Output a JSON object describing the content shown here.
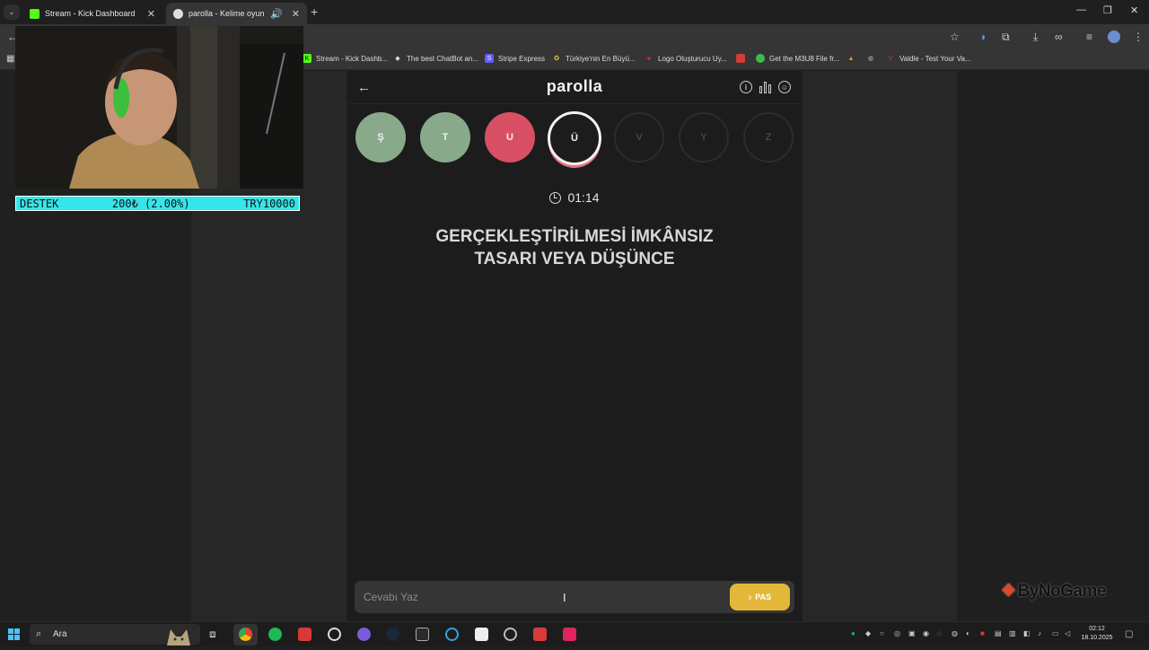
{
  "browser": {
    "tabs": [
      {
        "title": "Stream - Kick Dashboard",
        "favicon_color": "#53fc18"
      },
      {
        "title": "parolla - Kelime oyunu. Gün",
        "favicon_color": "#dddddd"
      }
    ],
    "bookmarks": [
      {
        "label": "Stream - Kick Dashb...",
        "icon_color": "#53fc18"
      },
      {
        "label": "The best ChatBot an...",
        "icon_color": "#bbbbbb"
      },
      {
        "label": "Stripe Express",
        "icon_color": "#635bff"
      },
      {
        "label": "Türkiye'nin En Büyü...",
        "icon_color": "#f5c542"
      },
      {
        "label": "Logo Oluşturucu Uy...",
        "icon_color": "#e0245e"
      },
      {
        "label": "",
        "icon_color": "#d43b3b"
      },
      {
        "label": "Get the M3U8 File fr...",
        "icon_color": "#3dbb4f"
      },
      {
        "label": "",
        "icon_color": "#f39c12"
      },
      {
        "label": "",
        "icon_color": "#aaaaaa"
      },
      {
        "label": "Valdle - Test Your Va...",
        "icon_color": "#e0245e"
      }
    ]
  },
  "overlay": {
    "support": {
      "label": "DESTEK",
      "amount": "200₺ (2.00%)",
      "goal": "TRY10000"
    },
    "sponsor": "ByNoGame"
  },
  "game": {
    "title": "parolla",
    "letters": [
      {
        "char": "Ş",
        "state": "correct"
      },
      {
        "char": "T",
        "state": "correct"
      },
      {
        "char": "U",
        "state": "wrong"
      },
      {
        "char": "Ü",
        "state": "current"
      },
      {
        "char": "V",
        "state": "pending"
      },
      {
        "char": "Y",
        "state": "pending"
      },
      {
        "char": "Z",
        "state": "pending"
      }
    ],
    "timer": "01:14",
    "question_line1": "GERÇEKLEŞTİRİLMESİ İMKÂNSIZ",
    "question_line2": "TASARI VEYA DÜŞÜNCE",
    "answer_placeholder": "Cevabı Yaz",
    "pass_label": "PAS"
  },
  "taskbar": {
    "search_label": "Ara",
    "time": "02:12",
    "date": "18.10.2025"
  }
}
